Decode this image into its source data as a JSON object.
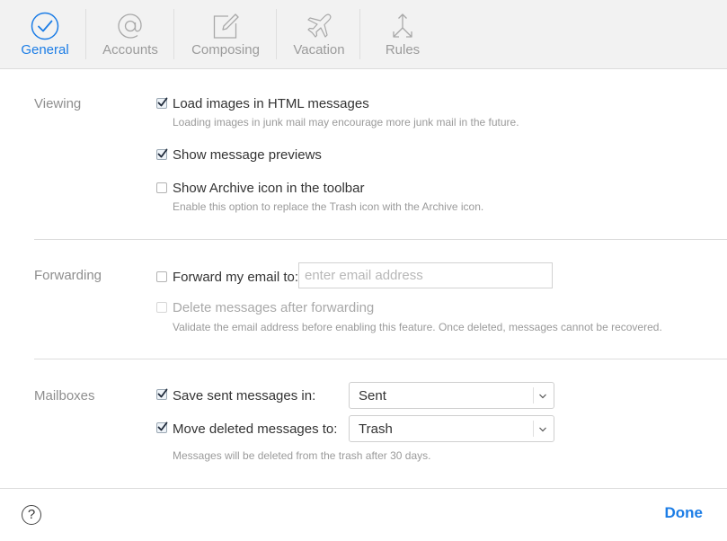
{
  "tabs": [
    {
      "label": "General",
      "icon": "checkmark-circle-icon",
      "active": true
    },
    {
      "label": "Accounts",
      "icon": "at-sign-icon"
    },
    {
      "label": "Composing",
      "icon": "compose-icon"
    },
    {
      "label": "Vacation",
      "icon": "airplane-icon"
    },
    {
      "label": "Rules",
      "icon": "arrows-icon"
    }
  ],
  "viewing": {
    "label": "Viewing",
    "load_images": {
      "label": "Load images in HTML messages",
      "hint": "Loading images in junk mail may encourage more junk mail in the future.",
      "checked": true
    },
    "show_previews": {
      "label": "Show message previews",
      "checked": true
    },
    "show_archive": {
      "label": "Show Archive icon in the toolbar",
      "hint": "Enable this option to replace the Trash icon with the Archive icon.",
      "checked": false
    }
  },
  "forwarding": {
    "label": "Forwarding",
    "forward": {
      "label": "Forward my email to:",
      "checked": false
    },
    "email_placeholder": "enter email address",
    "delete_after": {
      "label": "Delete messages after forwarding",
      "hint": "Validate the email address before enabling this feature. Once deleted, messages cannot be recovered.",
      "checked": false
    }
  },
  "mailboxes": {
    "label": "Mailboxes",
    "save_sent": {
      "label": "Save sent messages in:",
      "checked": true,
      "value": "Sent"
    },
    "move_deleted": {
      "label": "Move deleted messages to:",
      "checked": true,
      "value": "Trash"
    },
    "hint": "Messages will be deleted from the trash after 30 days."
  },
  "footer": {
    "help": "?",
    "done": "Done"
  },
  "colors": {
    "accent": "#1c7de6",
    "muted": "#9b9b9b"
  }
}
